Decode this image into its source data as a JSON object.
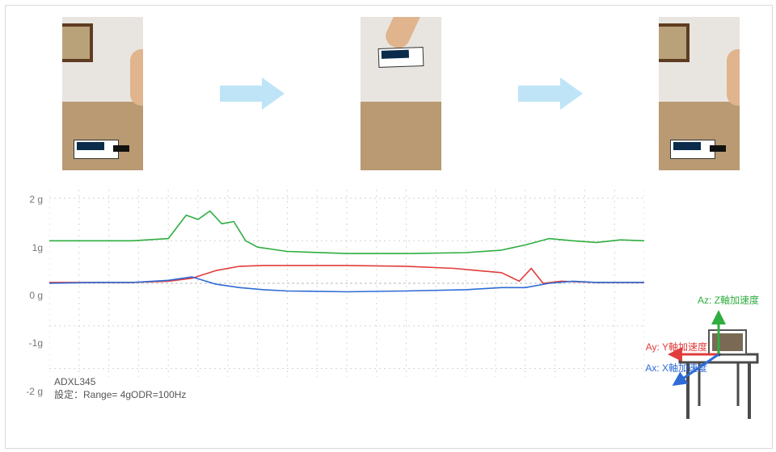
{
  "sensor_name": "ADXL345",
  "settings_line": "設定：Range= 4gODR=100Hz",
  "y_axis_ticks": [
    "2 g",
    "1g",
    "0 g",
    "-1g",
    "-2 g"
  ],
  "legend": {
    "az": "Az: Z軸加速度",
    "ay": "Ay: Y軸加速度",
    "ax": "Ax: X軸加速度"
  },
  "colors": {
    "ax": "#2e6bd6",
    "ay": "#e23b3b",
    "az": "#2eae3f",
    "grid": "#d5d5d5",
    "axis_mid": "#b9b9b9"
  },
  "chart_data": {
    "type": "line",
    "title": "",
    "xlabel": "",
    "ylabel": "g",
    "ylim": [
      -2.2,
      2.2
    ],
    "y_ticks": [
      2,
      1,
      0,
      -1,
      -2
    ],
    "x_range": [
      0,
      100
    ],
    "grid": true,
    "series": [
      {
        "name": "Az",
        "color": "#2eae3f",
        "x": [
          0,
          8,
          14,
          20,
          23,
          25,
          27,
          29,
          31,
          33,
          35,
          40,
          50,
          60,
          70,
          76,
          80,
          84,
          88,
          92,
          96,
          100
        ],
        "y": [
          1.0,
          1.0,
          1.0,
          1.05,
          1.6,
          1.5,
          1.7,
          1.4,
          1.45,
          1.0,
          0.85,
          0.75,
          0.7,
          0.7,
          0.72,
          0.78,
          0.9,
          1.05,
          1.0,
          0.96,
          1.02,
          1.0
        ]
      },
      {
        "name": "Ay",
        "color": "#e23b3b",
        "x": [
          0,
          8,
          14,
          20,
          24,
          28,
          32,
          36,
          40,
          50,
          60,
          68,
          72,
          76,
          79,
          81,
          83,
          86,
          92,
          100
        ],
        "y": [
          0.02,
          0.02,
          0.02,
          0.05,
          0.12,
          0.3,
          0.4,
          0.42,
          0.42,
          0.42,
          0.4,
          0.35,
          0.3,
          0.25,
          0.05,
          0.35,
          0.0,
          0.05,
          0.02,
          0.02
        ]
      },
      {
        "name": "Ax",
        "color": "#2e6bd6",
        "x": [
          0,
          8,
          14,
          20,
          24,
          28,
          32,
          36,
          40,
          50,
          60,
          70,
          76,
          80,
          84,
          88,
          92,
          100
        ],
        "y": [
          0.0,
          0.02,
          0.02,
          0.07,
          0.15,
          -0.02,
          -0.1,
          -0.15,
          -0.18,
          -0.2,
          -0.18,
          -0.15,
          -0.1,
          -0.1,
          0.0,
          0.05,
          0.02,
          0.02
        ]
      }
    ]
  }
}
